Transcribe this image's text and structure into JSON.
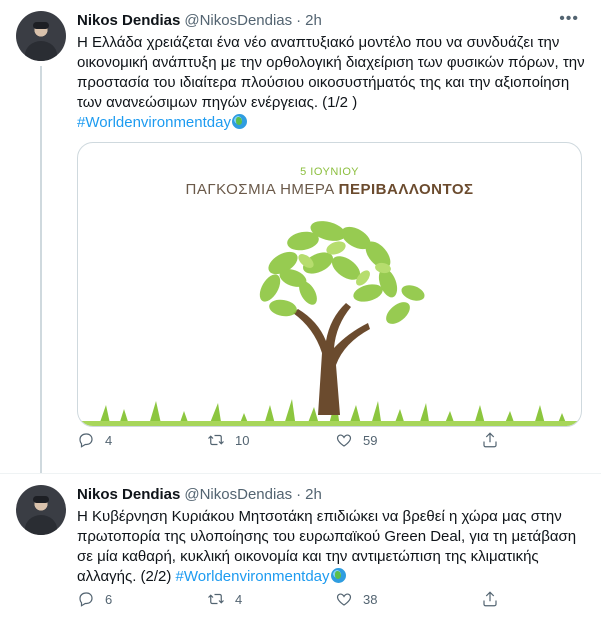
{
  "tweets": [
    {
      "author_name": "Nikos Dendias",
      "handle": "@NikosDendias",
      "separator": "·",
      "time": "2h",
      "text": "Η Ελλάδα χρειάζεται ένα νέο αναπτυξιακό μοντέλο που να συνδυάζει την οικονομική ανάπτυξη με την ορθολογική διαχείριση των φυσικών πόρων, την προστασία του ιδιαίτερα πλούσιου οικοσυστήματός της και την αξιοποίηση των ανανεώσιμων πηγών ενέργειας. (1/2 )",
      "hashtag": "#Worldenvironmentday",
      "hashtag_icon": "globe-icon",
      "media": {
        "date": "5 ΙΟΥΝΙΟΥ",
        "title_prefix": "ΠΑΓΚΟΣΜΙΑ ΗΜΕΡΑ ",
        "title_bold": "ΠΕΡΙΒΑΛΛΟΝΤΟΣ"
      },
      "replies": "4",
      "retweets": "10",
      "likes": "59"
    },
    {
      "author_name": "Nikos Dendias",
      "handle": "@NikosDendias",
      "separator": "·",
      "time": "2h",
      "text": "Η Κυβέρνηση Κυριάκου Μητσοτάκη επιδιώκει να βρεθεί η χώρα μας στην πρωτοπορία της υλοποίησης του ευρωπαϊκού Green Deal, για τη μετάβαση σε μία καθαρή, κυκλική οικονομία και την αντιμετώπιση της κλιματικής αλλαγής. (2/2) ",
      "hashtag": "#Worldenvironmentday",
      "hashtag_icon": "globe-icon",
      "replies": "6",
      "retweets": "4",
      "likes": "38"
    }
  ],
  "icons": {
    "reply": "reply-icon",
    "retweet": "retweet-icon",
    "like": "heart-icon",
    "share": "share-icon",
    "more": "more-icon"
  },
  "colors": {
    "link": "#1d9bf0",
    "secondary_text": "#536471",
    "leaf_green": "#8cc63f",
    "trunk_brown": "#6b4b2e"
  }
}
